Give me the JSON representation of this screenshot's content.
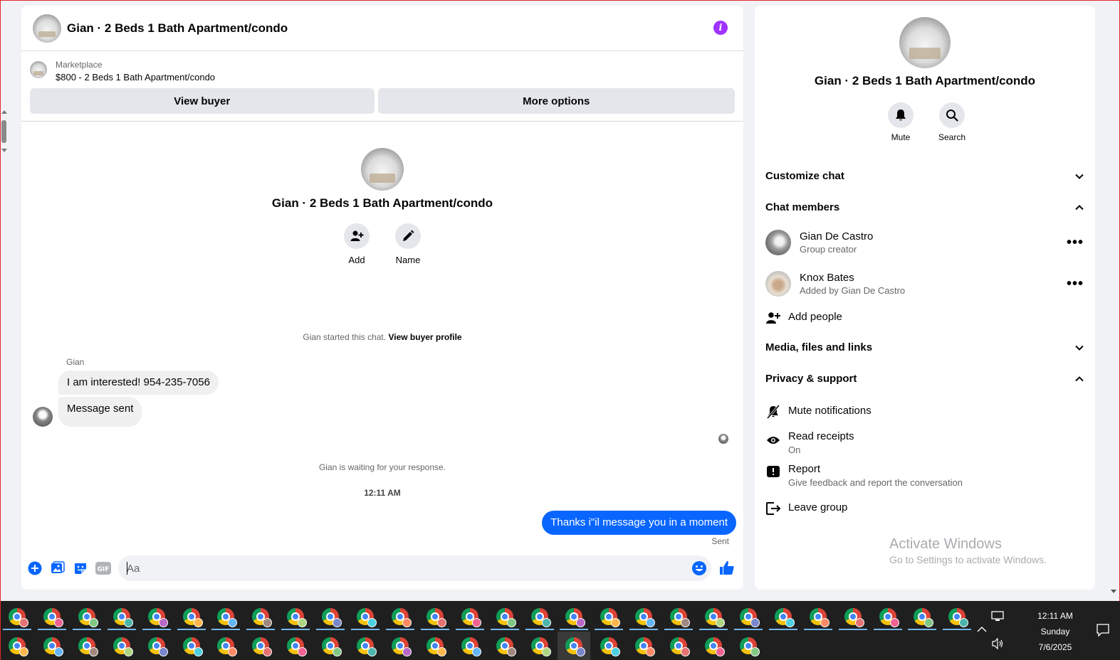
{
  "header": {
    "title": "Gian · 2 Beds 1 Bath Apartment/condo",
    "info_icon": "info-icon"
  },
  "marketplace": {
    "label": "Marketplace",
    "listing": "$800 - 2 Beds 1 Bath Apartment/condo",
    "view_buyer": "View buyer",
    "more_options": "More options"
  },
  "intro": {
    "title": "Gian · 2 Beds 1 Bath Apartment/condo",
    "add_label": "Add",
    "name_label": "Name"
  },
  "conversation": {
    "started_text": "Gian started this chat.",
    "started_link": "View buyer profile",
    "sender_name": "Gian",
    "messages_in": [
      "I am interested! 954-235-7056",
      "Message sent"
    ],
    "waiting_text": "Gian is waiting for your response.",
    "timestamp": "12:11 AM",
    "message_out": "Thanks i\"il message you in a moment",
    "sent_label": "Sent"
  },
  "composer": {
    "placeholder": "Aa"
  },
  "info_panel": {
    "title": "Gian · 2 Beds 1 Bath Apartment/condo",
    "mute_label": "Mute",
    "search_label": "Search",
    "customize_chat": "Customize chat",
    "chat_members": "Chat members",
    "members": [
      {
        "name": "Gian De Castro",
        "role": "Group creator"
      },
      {
        "name": "Knox Bates",
        "role": "Added by Gian De Castro"
      }
    ],
    "add_people": "Add people",
    "media": "Media, files and links",
    "privacy": "Privacy & support",
    "mute_notifications": "Mute notifications",
    "read_receipts": "Read receipts",
    "read_receipts_value": "On",
    "report": "Report",
    "report_sub": "Give feedback and report the conversation",
    "leave_group": "Leave group"
  },
  "watermark": {
    "line1": "Activate Windows",
    "line2": "Go to Settings to activate Windows."
  },
  "taskbar": {
    "time": "12:11 AM",
    "day": "Sunday",
    "date": "7/6/2025"
  },
  "colors": {
    "accent": "#0866ff",
    "info": "#a033ff"
  }
}
